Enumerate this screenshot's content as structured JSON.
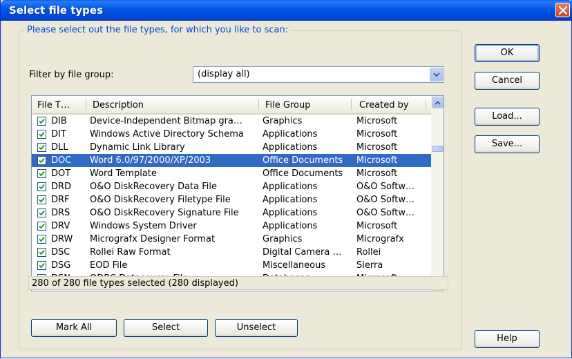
{
  "window": {
    "title": "Select file types"
  },
  "group": {
    "legend": "Please select out the file types, for which you like to scan:"
  },
  "filter": {
    "label": "Filter by file group:",
    "value": "(display all)"
  },
  "list": {
    "columns": [
      "File T…",
      "Description",
      "File Group",
      "Created by"
    ],
    "rows": [
      {
        "type": "DIB",
        "description": "Device-Independent Bitmap gra…",
        "group": "Graphics",
        "created_by": "Microsoft",
        "checked": true
      },
      {
        "type": "DIT",
        "description": "Windows Active Directory Schema",
        "group": "Applications",
        "created_by": "Microsoft",
        "checked": true
      },
      {
        "type": "DLL",
        "description": "Dynamic Link Library",
        "group": "Applications",
        "created_by": "Microsoft",
        "checked": true
      },
      {
        "type": "DOC",
        "description": "Word 6.0/97/2000/XP/2003",
        "group": "Office Documents",
        "created_by": "Microsoft",
        "checked": true,
        "selected": true
      },
      {
        "type": "DOT",
        "description": "Word Template",
        "group": "Office Documents",
        "created_by": "Microsoft",
        "checked": true
      },
      {
        "type": "DRD",
        "description": "O&O DiskRecovery Data File",
        "group": "Applications",
        "created_by": "O&O Softw…",
        "checked": true
      },
      {
        "type": "DRF",
        "description": "O&O DiskRecovery Filetype File",
        "group": "Applications",
        "created_by": "O&O Softw…",
        "checked": true
      },
      {
        "type": "DRS",
        "description": "O&O DiskRecovery Signature File",
        "group": "Applications",
        "created_by": "O&O Softw…",
        "checked": true
      },
      {
        "type": "DRV",
        "description": "Windows System Driver",
        "group": "Applications",
        "created_by": "Microsoft",
        "checked": true
      },
      {
        "type": "DRW",
        "description": "Micrografx Designer Format",
        "group": "Graphics",
        "created_by": "Micrografx",
        "checked": true
      },
      {
        "type": "DSC",
        "description": "Rollei Raw Format",
        "group": "Digital Camera …",
        "created_by": "Rollei",
        "checked": true
      },
      {
        "type": "DSG",
        "description": "EOD File",
        "group": "Miscellaneous",
        "created_by": "Sierra",
        "checked": true
      },
      {
        "type": "DSN",
        "description": "ODBC Datasource File",
        "group": "Databases",
        "created_by": "Microsoft",
        "checked": true
      }
    ]
  },
  "status": "280 of 280 file types selected (280 displayed)",
  "buttons": {
    "mark_all": "Mark All",
    "select": "Select",
    "unselect": "Unselect",
    "ok": "OK",
    "cancel": "Cancel",
    "load": "Load...",
    "save": "Save...",
    "help": "Help"
  },
  "colors": {
    "title_bar": "#0054e3",
    "selection": "#316ac5",
    "legend_text": "#0046d5",
    "dialog_bg": "#ece9d8"
  },
  "icons": {
    "close": "close-icon",
    "dropdown": "chevron-down-icon",
    "checkbox": "checkmark-icon"
  }
}
